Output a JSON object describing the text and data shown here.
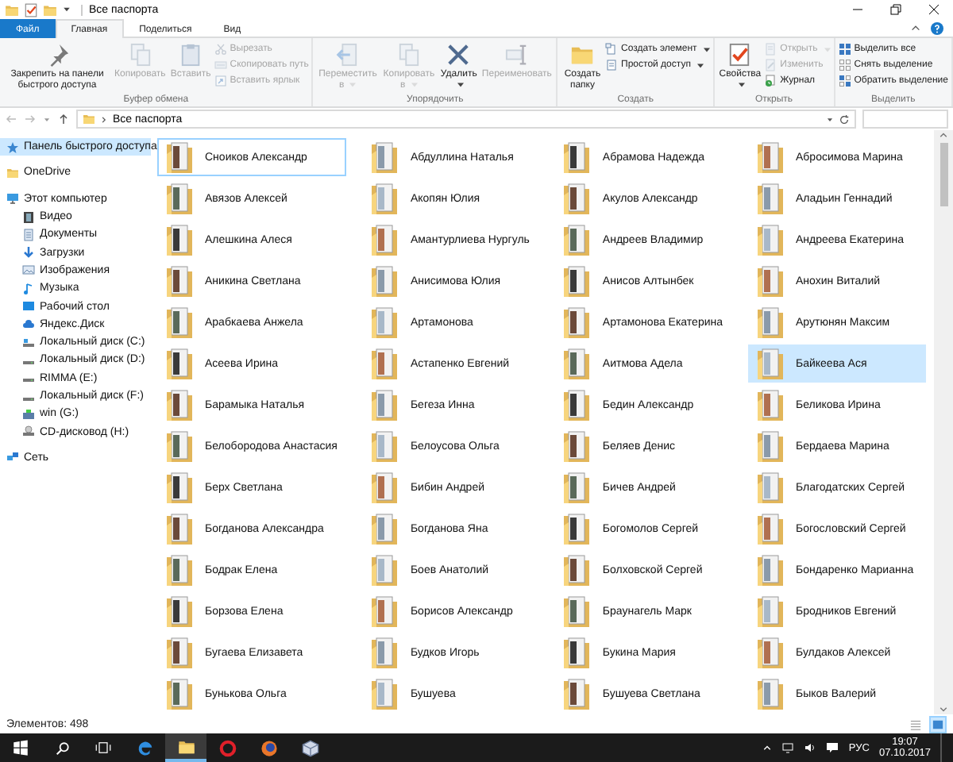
{
  "window": {
    "title": "Все паспорта"
  },
  "tabs": [
    {
      "label": "Файл",
      "kind": "file",
      "selected": false
    },
    {
      "label": "Главная",
      "kind": "tab",
      "selected": true
    },
    {
      "label": "Поделиться",
      "kind": "tab",
      "selected": false
    },
    {
      "label": "Вид",
      "kind": "tab",
      "selected": false
    }
  ],
  "ribbon": {
    "groups": [
      {
        "label": "Буфер обмена",
        "buttons": [
          {
            "kind": "large",
            "label": "Закрепить на панели быстрого доступа",
            "disabled": false,
            "dropdown": false
          },
          {
            "kind": "large",
            "label": "Копировать",
            "disabled": true,
            "dropdown": false
          },
          {
            "kind": "large",
            "label": "Вставить",
            "disabled": true,
            "dropdown": false
          },
          {
            "kind": "small",
            "label": "Вырезать",
            "disabled": true,
            "dropdown": false
          },
          {
            "kind": "small",
            "label": "Скопировать путь",
            "disabled": true,
            "dropdown": false
          },
          {
            "kind": "small",
            "label": "Вставить ярлык",
            "disabled": true,
            "dropdown": false
          }
        ]
      },
      {
        "label": "Упорядочить",
        "buttons": [
          {
            "kind": "large",
            "label": "Переместить в",
            "disabled": true,
            "dropdown": true
          },
          {
            "kind": "large",
            "label": "Копировать в",
            "disabled": true,
            "dropdown": true
          },
          {
            "kind": "large",
            "label": "Удалить",
            "disabled": false,
            "dropdown": true
          },
          {
            "kind": "large",
            "label": "Переименовать",
            "disabled": true,
            "dropdown": false
          }
        ]
      },
      {
        "label": "Создать",
        "buttons": [
          {
            "kind": "large",
            "label": "Создать папку",
            "disabled": false,
            "dropdown": false
          },
          {
            "kind": "small",
            "label": "Создать элемент",
            "disabled": false,
            "dropdown": true
          },
          {
            "kind": "small",
            "label": "Простой доступ",
            "disabled": false,
            "dropdown": true
          }
        ]
      },
      {
        "label": "Открыть",
        "buttons": [
          {
            "kind": "large",
            "label": "Свойства",
            "disabled": false,
            "dropdown": true
          },
          {
            "kind": "small",
            "label": "Открыть",
            "disabled": true,
            "dropdown": true
          },
          {
            "kind": "small",
            "label": "Изменить",
            "disabled": true,
            "dropdown": false
          },
          {
            "kind": "small",
            "label": "Журнал",
            "disabled": false,
            "dropdown": false
          }
        ]
      },
      {
        "label": "Выделить",
        "buttons": [
          {
            "kind": "small",
            "label": "Выделить все",
            "disabled": false,
            "dropdown": false
          },
          {
            "kind": "small",
            "label": "Снять выделение",
            "disabled": false,
            "dropdown": false
          },
          {
            "kind": "small",
            "label": "Обратить выделение",
            "disabled": false,
            "dropdown": false
          }
        ]
      }
    ]
  },
  "address": {
    "path": "Все паспорта"
  },
  "sidebar": {
    "items": [
      {
        "label": "Панель быстрого доступа",
        "kind": "quick",
        "selected": true
      },
      {
        "label": "OneDrive",
        "kind": "onedrive",
        "selected": false
      },
      {
        "label": "Этот компьютер",
        "kind": "pc",
        "selected": false,
        "children": [
          {
            "label": "Видео",
            "kind": "video",
            "selected": false
          },
          {
            "label": "Документы",
            "kind": "docs",
            "selected": false
          },
          {
            "label": "Загрузки",
            "kind": "downloads",
            "selected": false
          },
          {
            "label": "Изображения",
            "kind": "pictures",
            "selected": false
          },
          {
            "label": "Музыка",
            "kind": "music",
            "selected": false
          },
          {
            "label": "Рабочий стол",
            "kind": "desktop",
            "selected": false
          },
          {
            "label": "Яндекс.Диск",
            "kind": "cloud",
            "selected": false
          },
          {
            "label": "Локальный диск (C:)",
            "kind": "system",
            "selected": false
          },
          {
            "label": "Локальный диск (D:)",
            "kind": "drive",
            "selected": false
          },
          {
            "label": "RIMMA (E:)",
            "kind": "drive",
            "selected": false
          },
          {
            "label": "Локальный диск (F:)",
            "kind": "drive",
            "selected": false
          },
          {
            "label": "win (G:)",
            "kind": "usb",
            "selected": false
          },
          {
            "label": "CD-дисковод (H:)",
            "kind": "cd",
            "selected": false
          }
        ]
      },
      {
        "label": "Сеть",
        "kind": "network",
        "selected": false
      }
    ]
  },
  "folders": [
    {
      "name": "Сноиков Александр",
      "selected": false,
      "focused": true
    },
    {
      "name": "Абдуллина Наталья",
      "selected": false,
      "focused": false
    },
    {
      "name": "Абрамова Надежда",
      "selected": false,
      "focused": false
    },
    {
      "name": "Абросимова Марина",
      "selected": false,
      "focused": false
    },
    {
      "name": "Авязов Алексей",
      "selected": false,
      "focused": false
    },
    {
      "name": "Акопян Юлия",
      "selected": false,
      "focused": false
    },
    {
      "name": "Акулов Александр",
      "selected": false,
      "focused": false
    },
    {
      "name": "Аладьин Геннадий",
      "selected": false,
      "focused": false
    },
    {
      "name": "Алешкина Алеся",
      "selected": false,
      "focused": false
    },
    {
      "name": "Амантурлиева Нургуль",
      "selected": false,
      "focused": false
    },
    {
      "name": "Андреев Владимир",
      "selected": false,
      "focused": false
    },
    {
      "name": "Андреева Екатерина",
      "selected": false,
      "focused": false
    },
    {
      "name": "Аникина Светлана",
      "selected": false,
      "focused": false
    },
    {
      "name": "Анисимова Юлия",
      "selected": false,
      "focused": false
    },
    {
      "name": "Анисов Алтынбек",
      "selected": false,
      "focused": false
    },
    {
      "name": "Анохин Виталий",
      "selected": false,
      "focused": false
    },
    {
      "name": "Арабкаева Анжела",
      "selected": false,
      "focused": false
    },
    {
      "name": "Артамонова",
      "selected": false,
      "focused": false
    },
    {
      "name": "Артамонова Екатерина",
      "selected": false,
      "focused": false
    },
    {
      "name": "Арутюнян Максим",
      "selected": false,
      "focused": false
    },
    {
      "name": "Асеева Ирина",
      "selected": false,
      "focused": false
    },
    {
      "name": "Астапенко Евгений",
      "selected": false,
      "focused": false
    },
    {
      "name": "Аитмова Адела",
      "selected": false,
      "focused": false
    },
    {
      "name": "Байкеева Ася",
      "selected": true,
      "focused": false
    },
    {
      "name": "Барамыка Наталья",
      "selected": false,
      "focused": false
    },
    {
      "name": "Бегеза Инна",
      "selected": false,
      "focused": false
    },
    {
      "name": "Бедин Александр",
      "selected": false,
      "focused": false
    },
    {
      "name": "Беликова Ирина",
      "selected": false,
      "focused": false
    },
    {
      "name": "Белобородова Анастасия",
      "selected": false,
      "focused": false
    },
    {
      "name": "Белоусова Ольга",
      "selected": false,
      "focused": false
    },
    {
      "name": "Беляев Денис",
      "selected": false,
      "focused": false
    },
    {
      "name": "Бердаева Марина",
      "selected": false,
      "focused": false
    },
    {
      "name": "Берх Светлана",
      "selected": false,
      "focused": false
    },
    {
      "name": "Бибин Андрей",
      "selected": false,
      "focused": false
    },
    {
      "name": "Бичев Андрей",
      "selected": false,
      "focused": false
    },
    {
      "name": "Благодатских Сергей",
      "selected": false,
      "focused": false
    },
    {
      "name": "Богданова Александра",
      "selected": false,
      "focused": false
    },
    {
      "name": "Богданова Яна",
      "selected": false,
      "focused": false
    },
    {
      "name": "Богомолов Сергей",
      "selected": false,
      "focused": false
    },
    {
      "name": "Богословский Сергей",
      "selected": false,
      "focused": false
    },
    {
      "name": "Бодрак Елена",
      "selected": false,
      "focused": false
    },
    {
      "name": "Боев Анатолий",
      "selected": false,
      "focused": false
    },
    {
      "name": "Болховской Сергей",
      "selected": false,
      "focused": false
    },
    {
      "name": "Бондаренко Марианна",
      "selected": false,
      "focused": false
    },
    {
      "name": "Борзова Елена",
      "selected": false,
      "focused": false
    },
    {
      "name": "Борисов Александр",
      "selected": false,
      "focused": false
    },
    {
      "name": "Браунагель Марк",
      "selected": false,
      "focused": false
    },
    {
      "name": "Бродников Евгений",
      "selected": false,
      "focused": false
    },
    {
      "name": "Бугаева Елизавета",
      "selected": false,
      "focused": false
    },
    {
      "name": "Будков Игорь",
      "selected": false,
      "focused": false
    },
    {
      "name": "Букина Мария",
      "selected": false,
      "focused": false
    },
    {
      "name": "Булдаков Алексей",
      "selected": false,
      "focused": false
    },
    {
      "name": "Бунькова Ольга",
      "selected": false,
      "focused": false
    },
    {
      "name": "Бушуева",
      "selected": false,
      "focused": false
    },
    {
      "name": "Бушуева Светлана",
      "selected": false,
      "focused": false
    },
    {
      "name": "Быков Валерий",
      "selected": false,
      "focused": false
    }
  ],
  "status_bar": {
    "text": "Элементов: 498",
    "view_buttons": [
      {
        "kind": "details",
        "selected": false
      },
      {
        "kind": "icons",
        "selected": true
      }
    ]
  },
  "taskbar": {
    "apps": [
      {
        "kind": "explorer",
        "active": true
      },
      {
        "kind": "opera",
        "active": false
      },
      {
        "kind": "firefox",
        "active": false
      },
      {
        "kind": "box",
        "active": false
      }
    ],
    "language": "РУС",
    "time": "19:07",
    "date": "07.10.2017"
  }
}
